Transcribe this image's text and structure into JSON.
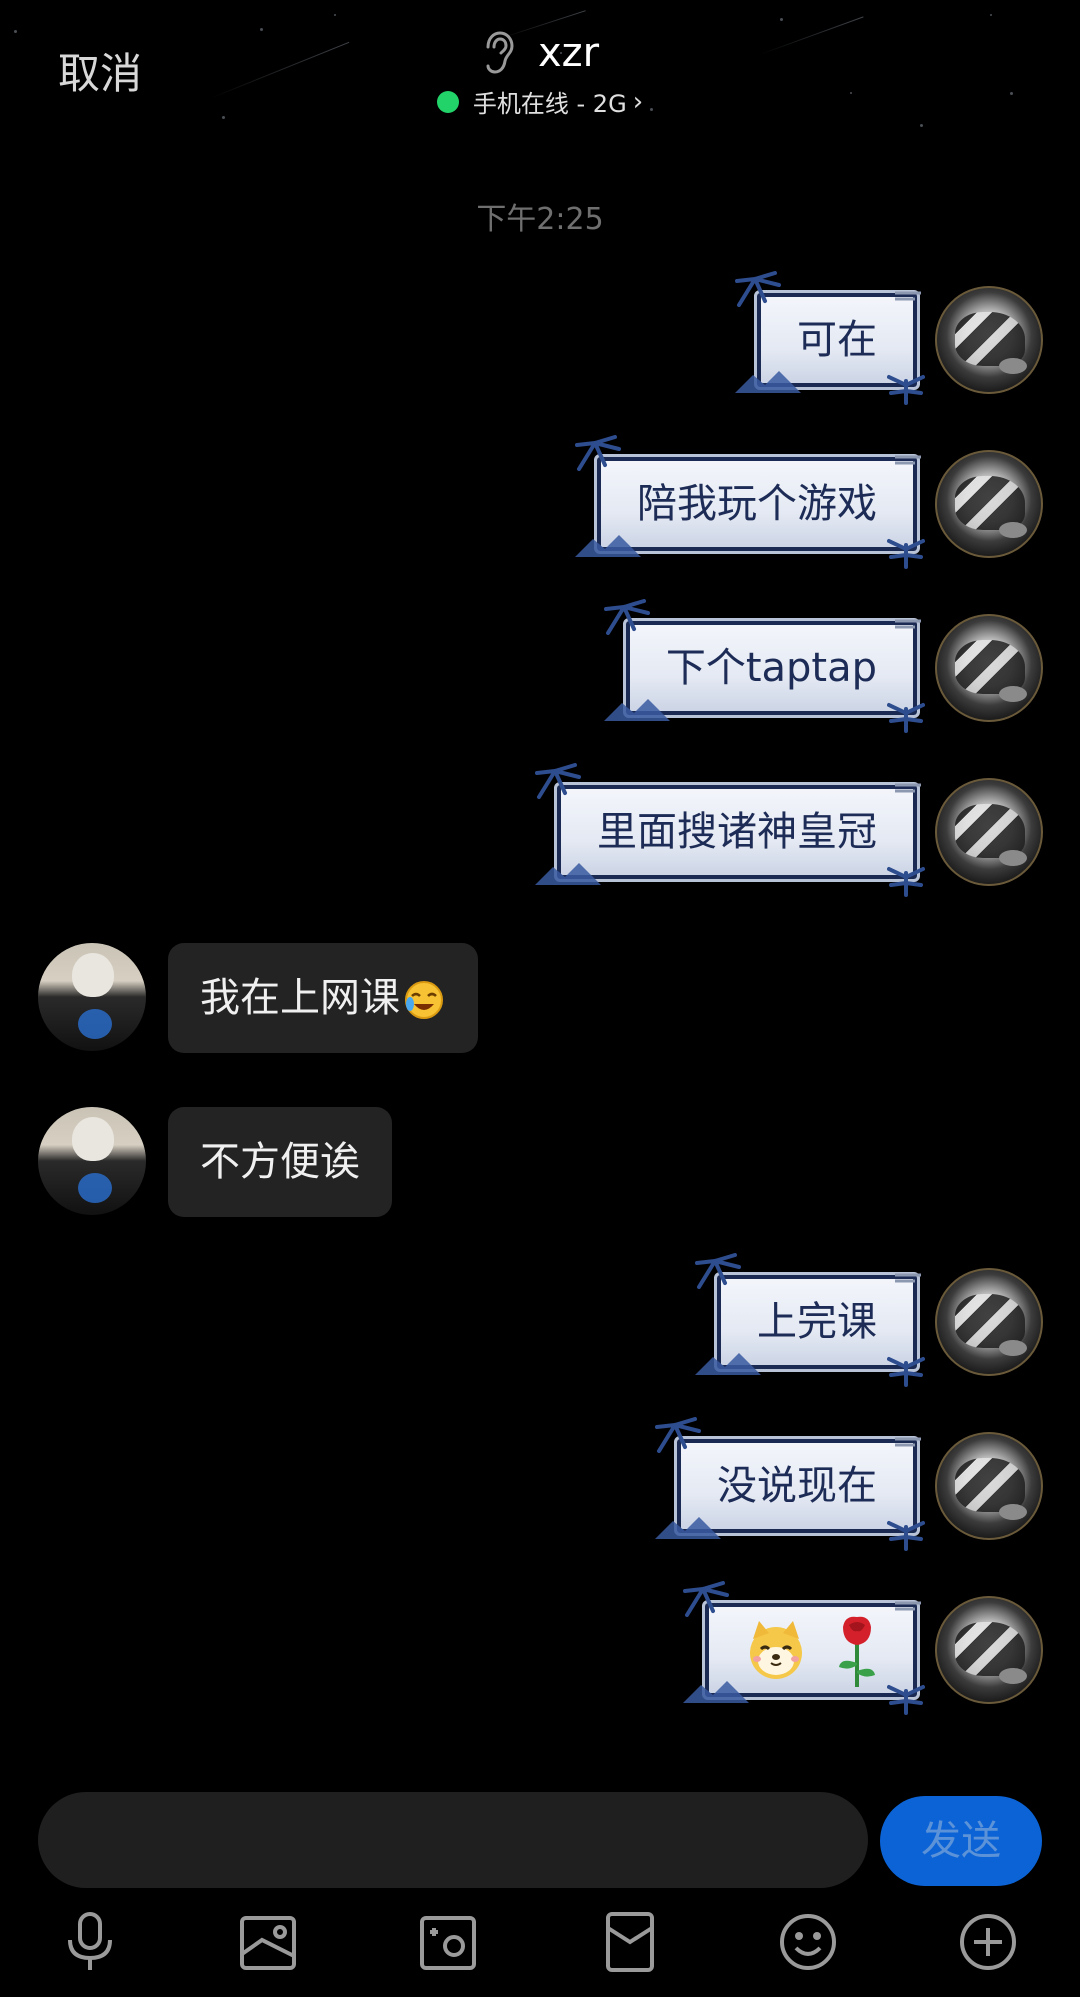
{
  "header": {
    "cancel_label": "取消",
    "contact_name": "xzr",
    "status": "手机在线 - 2G",
    "status_chevron": "›",
    "online_color": "#22d36a",
    "ear_icon": "ear-icon"
  },
  "timestamp": "下午2:25",
  "messages": [
    {
      "sender": "me",
      "text": "可在"
    },
    {
      "sender": "me",
      "text": "陪我玩个游戏"
    },
    {
      "sender": "me",
      "text": "下个taptap"
    },
    {
      "sender": "me",
      "text": "里面搜诸神皇冠"
    },
    {
      "sender": "other",
      "text": "我在上网课",
      "emoji": "laugh-cry-emoji"
    },
    {
      "sender": "other",
      "text": "不方便诶"
    },
    {
      "sender": "me",
      "text": "上完课"
    },
    {
      "sender": "me",
      "text": "没说现在"
    },
    {
      "sender": "me",
      "text": "",
      "stickers": [
        "dog-sticker",
        "rose-emoji"
      ]
    }
  ],
  "input": {
    "placeholder": "",
    "send_label": "发送",
    "send_color": "#0b63d6"
  },
  "toolbar": {
    "icons": [
      "microphone-icon",
      "image-icon",
      "camera-icon",
      "red-packet-icon",
      "emoji-icon",
      "plus-icon"
    ]
  }
}
